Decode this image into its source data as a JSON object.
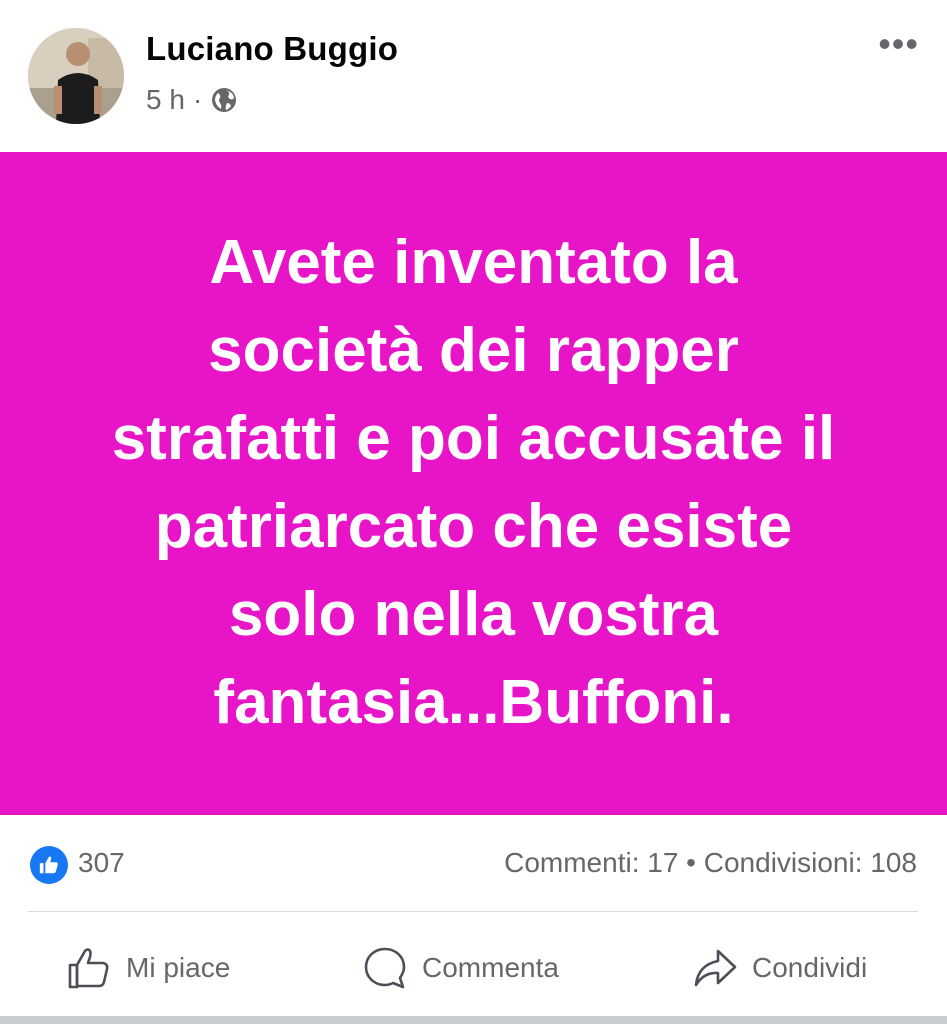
{
  "post": {
    "author": "Luciano Buggio",
    "time": "5 h",
    "separator": "·",
    "audience_icon": "globe-icon",
    "more_icon": "more-options-icon",
    "text": "Avete inventato la\nsocietà dei rapper\nstrafatti e poi accusate il\npatriarcato che esiste\nsolo nella vostra\nfantasia...Buffoni.",
    "background_color": "#e814c7"
  },
  "stats": {
    "likes": "307",
    "comments_shares": "Commenti: 17 • Condivisioni: 108"
  },
  "actions": {
    "like": "Mi piace",
    "comment": "Commenta",
    "share": "Condividi"
  },
  "colors": {
    "accent": "#1877f2",
    "secondary_text": "#65676b"
  }
}
